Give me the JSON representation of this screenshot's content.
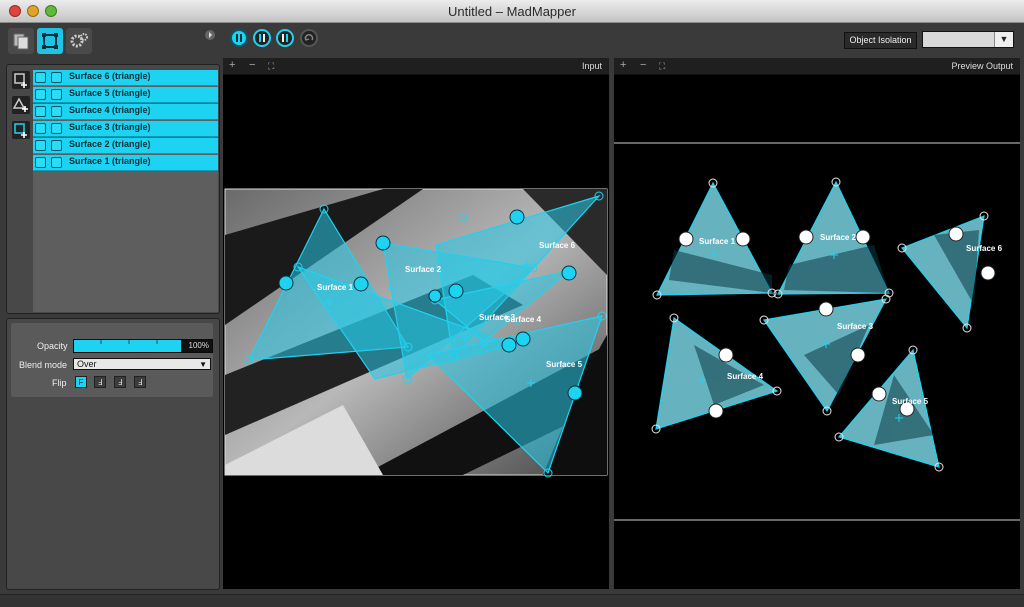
{
  "window": {
    "title": "Untitled – MadMapper"
  },
  "left_tabs": [
    {
      "name": "media-icon"
    },
    {
      "name": "surfaces-icon"
    },
    {
      "name": "settings-icon"
    }
  ],
  "surfaces": [
    {
      "label": "Surface 6 (triangle)"
    },
    {
      "label": "Surface 5 (triangle)"
    },
    {
      "label": "Surface 4 (triangle)"
    },
    {
      "label": "Surface 3 (triangle)"
    },
    {
      "label": "Surface 2 (triangle)"
    },
    {
      "label": "Surface 1 (triangle)"
    }
  ],
  "properties": {
    "opacity_label": "Opacity",
    "opacity_value": "100%",
    "opacity_fraction": 1.0,
    "blend_label": "Blend mode",
    "blend_value": "Over",
    "flip_label": "Flip",
    "flip_buttons": [
      "F",
      "Ⅎ",
      "Ⅎ",
      "Ⅎ"
    ]
  },
  "toolbar": {
    "object_isolation_label": "Object Isolation",
    "dropdown_arrow": "▼"
  },
  "input_view": {
    "title": "Input",
    "plus": "+",
    "minus": "−",
    "fit": "⛶"
  },
  "output_view": {
    "title": "Preview Output",
    "plus": "+",
    "minus": "−",
    "fit": "⛶"
  },
  "input_surface_labels": {
    "s1": "Surface 1",
    "s2": "Surface 2",
    "s3": "Surface 3",
    "s4": "Surface 4",
    "s5": "Surface 5",
    "s6": "Surface 6"
  },
  "output_surface_labels": {
    "s1": "Surface 1",
    "s2": "Surface 2",
    "s3": "Surface 3",
    "s4": "Surface 4",
    "s5": "Surface 5",
    "s6": "Surface 6"
  },
  "colors": {
    "accent": "#1ed3f2",
    "panel": "#484848",
    "background": "#3a3a3a"
  }
}
